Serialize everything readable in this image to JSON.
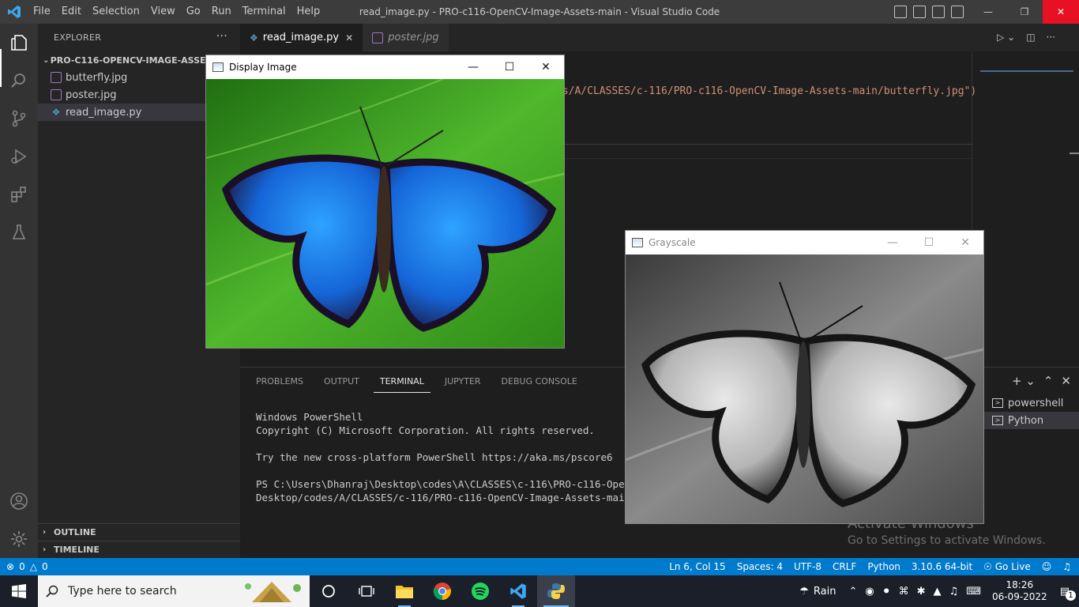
{
  "titlebar": {
    "menu": [
      "File",
      "Edit",
      "Selection",
      "View",
      "Go",
      "Run",
      "Terminal",
      "Help"
    ],
    "window_title": "read_image.py - PRO-c116-OpenCV-Image-Assets-main - Visual Studio Code"
  },
  "sidebar": {
    "header": "EXPLORER",
    "folder": "PRO-C116-OPENCV-IMAGE-ASSETS-M...",
    "files": [
      "butterfly.jpg",
      "poster.jpg",
      "read_image.py"
    ],
    "outline": "OUTLINE",
    "timeline": "TIMELINE"
  },
  "editor": {
    "tabs": [
      {
        "label": "read_image.py",
        "active": true
      },
      {
        "label": "poster.jpg",
        "active": false
      }
    ],
    "code_fragment": "es/A/CLASSES/c-116/PRO-c116-OpenCV-Image-Assets-main/butterfly.jpg\")"
  },
  "panel": {
    "tabs": [
      "PROBLEMS",
      "OUTPUT",
      "TERMINAL",
      "JUPYTER",
      "DEBUG CONSOLE"
    ],
    "active_tab": "TERMINAL",
    "terminal_lines": [
      "Windows PowerShell",
      "Copyright (C) Microsoft Corporation. All rights reserved.",
      "",
      "Try the new cross-platform PowerShell https://aka.ms/pscore6",
      "",
      "PS C:\\Users\\Dhanraj\\Desktop\\codes\\A\\CLASSES\\c-116\\PRO-c116-OpenCV-I",
      "Desktop/codes/A/CLASSES/c-116/PRO-c116-OpenCV-Image-Assets-main/rea"
    ],
    "terminals": [
      "powershell",
      "Python"
    ]
  },
  "cv_windows": {
    "display_title": "Display Image",
    "gray_title": "Grayscale"
  },
  "watermark": {
    "line1": "Activate Windows",
    "line2": "Go to Settings to activate Windows."
  },
  "statusbar": {
    "errors": "0",
    "warnings": "0",
    "position": "Ln 6, Col 15",
    "spaces": "Spaces: 4",
    "encoding": "UTF-8",
    "eol": "CRLF",
    "language": "Python",
    "interpreter": "3.10.6 64-bit",
    "golive": "Go Live"
  },
  "taskbar": {
    "search_placeholder": "Type here to search",
    "weather": "Rain",
    "time": "18:26",
    "date": "06-09-2022",
    "notifications": "1"
  },
  "colors": {
    "accent": "#007acc",
    "butterfly_blue": "#1e88e5",
    "leaf_green": "#3fae2a"
  }
}
